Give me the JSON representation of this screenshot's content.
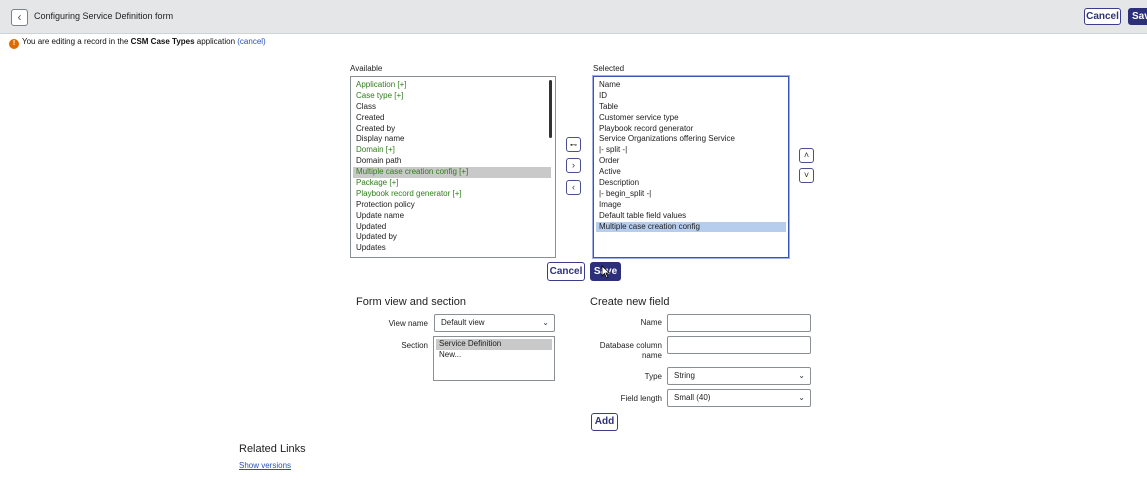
{
  "header": {
    "title": "Configuring Service Definition form",
    "cancel_label": "Cancel",
    "save_label": "Save"
  },
  "notice": {
    "prefix": "You are editing a record in the ",
    "app_name": "CSM Case Types",
    "suffix": " application ",
    "link": "(cancel)"
  },
  "slush": {
    "available_label": "Available",
    "selected_label": "Selected",
    "available_items": [
      {
        "label": "Application [+]",
        "green": true
      },
      {
        "label": "Case type [+]",
        "green": true
      },
      {
        "label": "Class"
      },
      {
        "label": "Created"
      },
      {
        "label": "Created by"
      },
      {
        "label": "Display name"
      },
      {
        "label": "Domain [+]",
        "green": true
      },
      {
        "label": "Domain path"
      },
      {
        "label": "Multiple case creation config [+]",
        "green": true,
        "selected": true
      },
      {
        "label": "Package [+]",
        "green": true
      },
      {
        "label": "Playbook record generator [+]",
        "green": true
      },
      {
        "label": "Protection policy"
      },
      {
        "label": "Update name"
      },
      {
        "label": "Updated"
      },
      {
        "label": "Updated by"
      },
      {
        "label": "Updates"
      }
    ],
    "selected_items": [
      {
        "label": "Name"
      },
      {
        "label": "ID"
      },
      {
        "label": "Table"
      },
      {
        "label": "Customer service type"
      },
      {
        "label": "Playbook record generator"
      },
      {
        "label": "Service Organizations offering Service"
      },
      {
        "label": "|- split -|"
      },
      {
        "label": "Order"
      },
      {
        "label": "Active"
      },
      {
        "label": "Description"
      },
      {
        "label": "|- begin_split -|"
      },
      {
        "label": "Image"
      },
      {
        "label": "Default table field values"
      },
      {
        "label": "Multiple case creation config",
        "selected": true
      }
    ],
    "cancel_label": "Cancel",
    "save_label": "Save"
  },
  "form_view": {
    "title": "Form view and section",
    "view_name_label": "View name",
    "view_name_value": "Default view",
    "section_label": "Section",
    "sections": [
      "Service Definition",
      "New..."
    ]
  },
  "new_field": {
    "title": "Create new field",
    "name_label": "Name",
    "db_column_label_1": "Database column",
    "db_column_label_2": "name",
    "type_label": "Type",
    "type_value": "String",
    "length_label": "Field length",
    "length_value": "Small (40)",
    "add_label": "Add"
  },
  "related": {
    "title": "Related Links",
    "show_versions": "Show versions"
  }
}
